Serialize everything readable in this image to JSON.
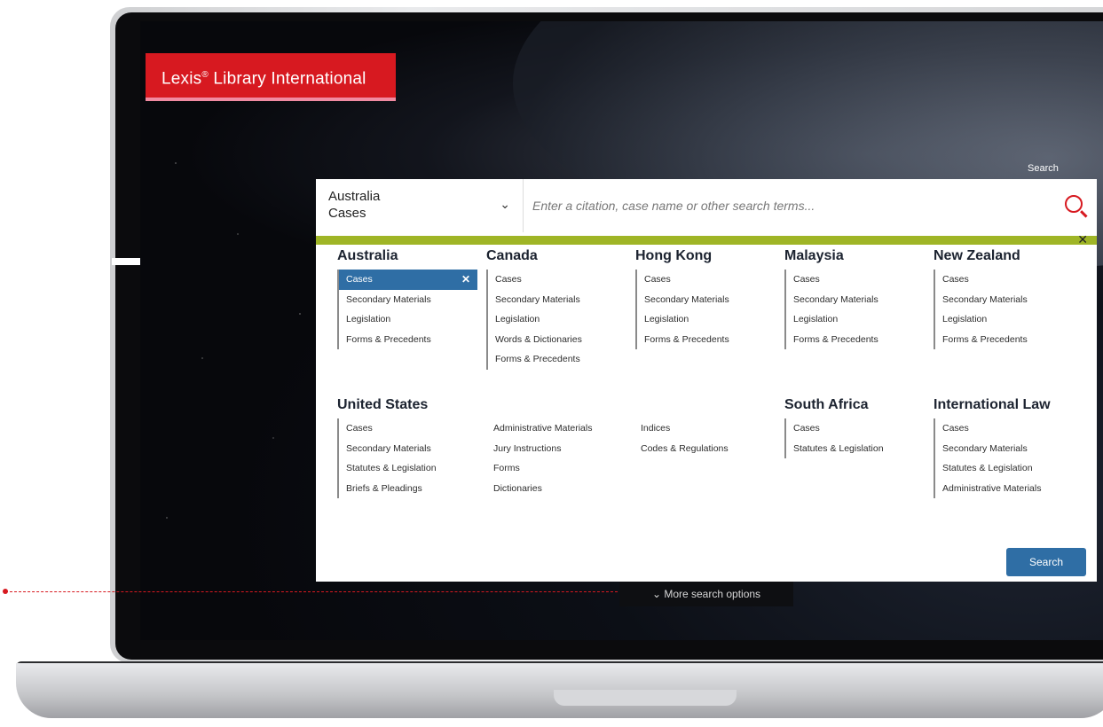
{
  "brand": {
    "name": "Lexis",
    "reg": "®",
    "product": " Library International"
  },
  "header": {
    "search_label": "Search"
  },
  "selector": {
    "line1": "Australia",
    "line2": "Cases"
  },
  "search": {
    "placeholder": "Enter a citation, case name or other search terms..."
  },
  "groups": [
    {
      "title": "Australia",
      "items": [
        "Cases",
        "Secondary Materials",
        "Legislation",
        "Forms & Precedents"
      ],
      "active": 0
    },
    {
      "title": "Canada",
      "items": [
        "Cases",
        "Secondary Materials",
        "Legislation",
        "Words & Dictionaries",
        "Forms & Precedents"
      ]
    },
    {
      "title": "Hong Kong",
      "items": [
        "Cases",
        "Secondary Materials",
        "Legislation",
        "Forms & Precedents"
      ]
    },
    {
      "title": "Malaysia",
      "items": [
        "Cases",
        "Secondary Materials",
        "Legislation",
        "Forms & Precedents"
      ]
    },
    {
      "title": "New Zealand",
      "items": [
        "Cases",
        "Secondary Materials",
        "Legislation",
        "Forms & Precedents"
      ]
    }
  ],
  "us": {
    "title": "United States",
    "col1": [
      "Cases",
      "Secondary Materials",
      "Statutes & Legislation",
      "Briefs & Pleadings"
    ],
    "col2": [
      "Administrative Materials",
      "Jury Instructions",
      "Forms",
      "Dictionaries"
    ],
    "col3": [
      "Indices",
      "Codes & Regulations"
    ]
  },
  "south_africa": {
    "title": "South Africa",
    "items": [
      "Cases",
      "Statutes & Legislation"
    ]
  },
  "international": {
    "title": "International Law",
    "items": [
      "Cases",
      "Secondary Materials",
      "Statutes & Legislation",
      "Administrative Materials"
    ]
  },
  "buttons": {
    "search": "Search",
    "more_options": "More search options"
  },
  "colors": {
    "brand_red": "#d71920",
    "accent_blue": "#2f6ea5",
    "lime": "#9fb526"
  }
}
